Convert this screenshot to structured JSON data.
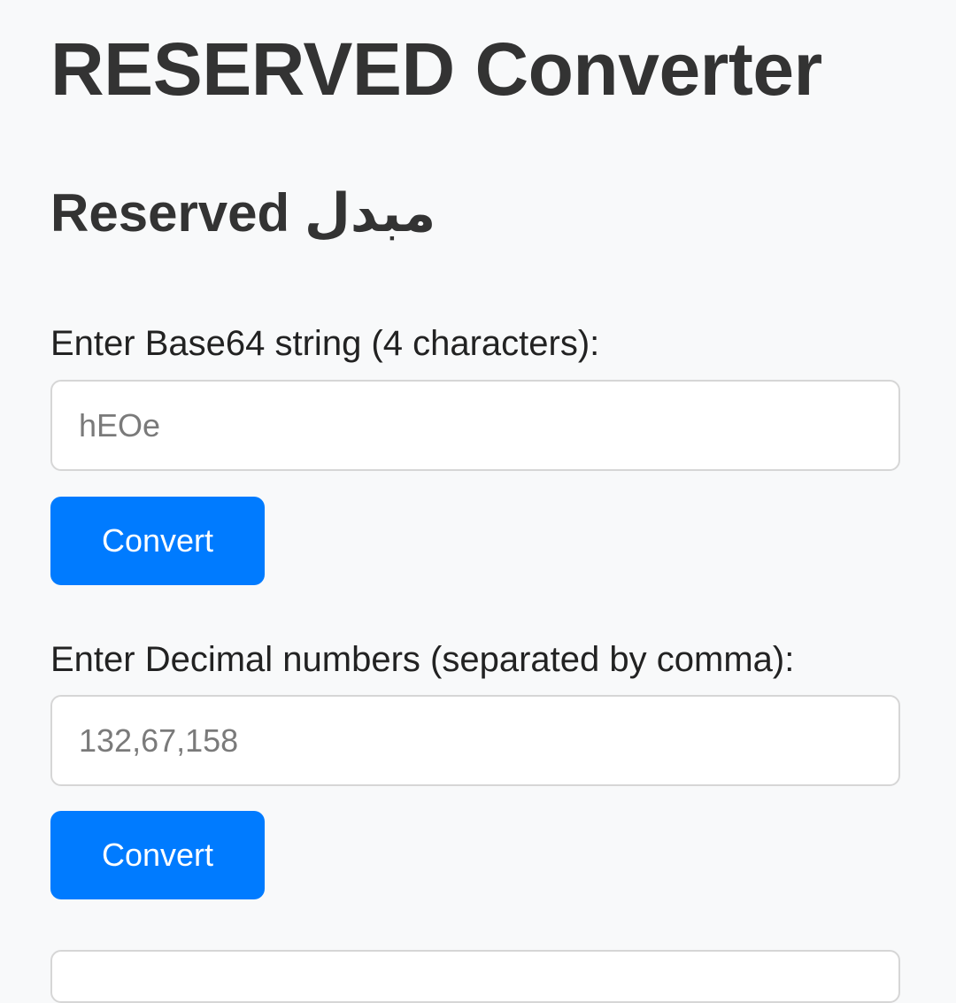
{
  "header": {
    "title": "RESERVED Converter"
  },
  "section": {
    "title": "Reserved مبدل"
  },
  "base64_form": {
    "label": "Enter Base64 string (4 characters):",
    "placeholder": "hEOe",
    "button_label": "Convert"
  },
  "decimal_form": {
    "label": "Enter Decimal numbers (separated by comma):",
    "placeholder": "132,67,158",
    "button_label": "Convert"
  },
  "colors": {
    "background": "#f8f9fa",
    "button": "#007bff",
    "button_text": "#ffffff",
    "heading": "#333333",
    "input_border": "#d6d6d6",
    "placeholder": "#7a7a7a"
  }
}
